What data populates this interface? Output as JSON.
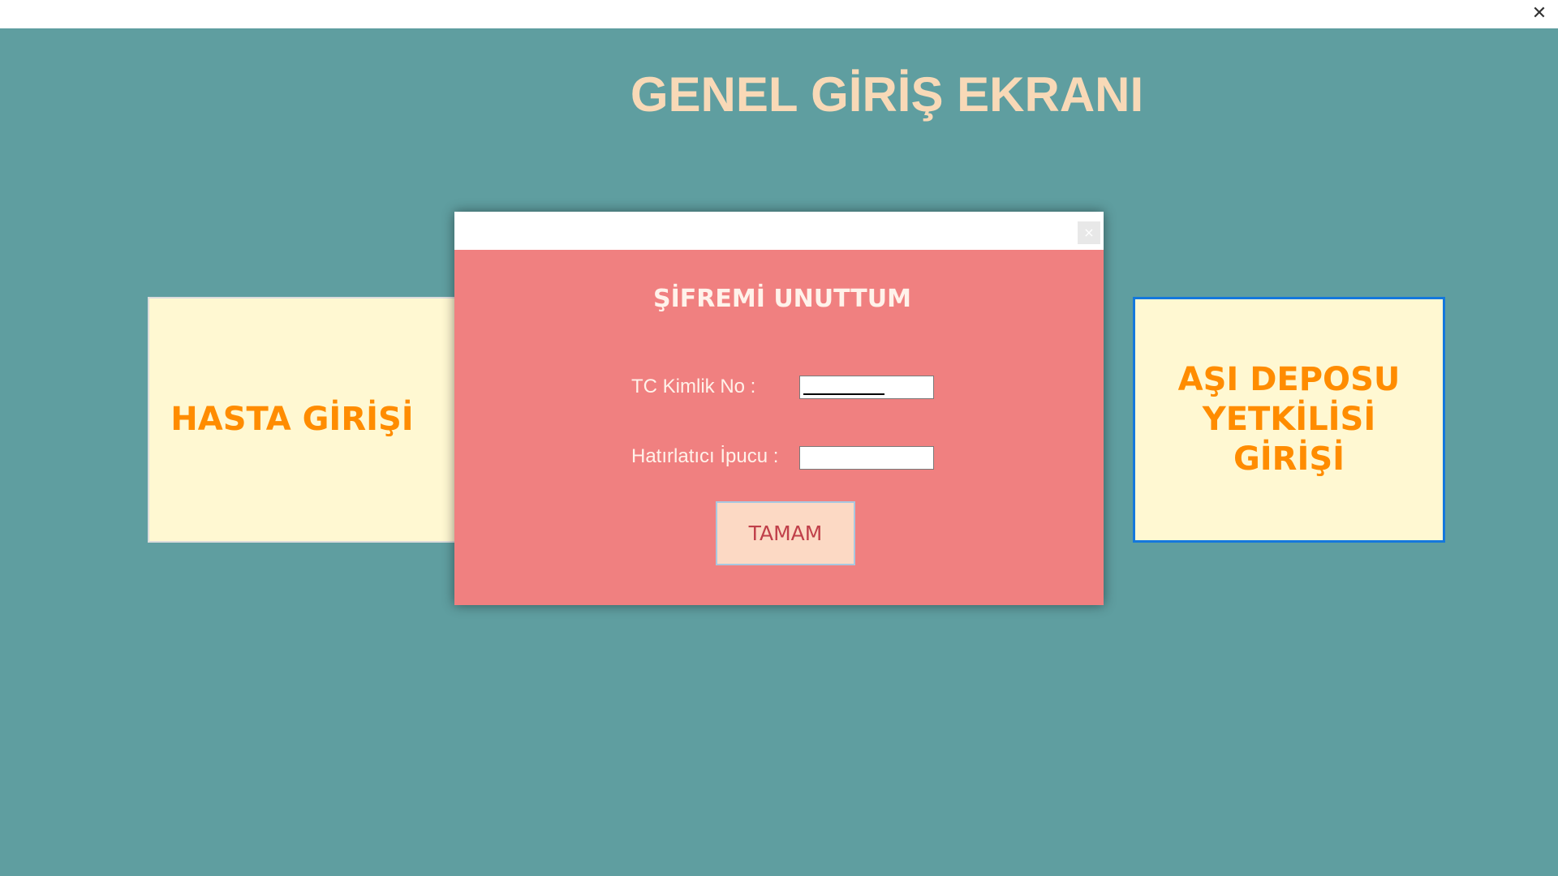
{
  "window": {
    "close_glyph": "✕",
    "title": "GENEL GİRİŞ EKRANI"
  },
  "buttons": {
    "hasta": "HASTA GİRİŞİ",
    "asi_line1": "AŞI DEPOSU",
    "asi_line2": "YETKİLİSİ",
    "asi_line3": "GİRİŞİ"
  },
  "dialog": {
    "close_glyph": "×",
    "heading": "ŞİFREMİ UNUTTUM",
    "tc_label": "TC Kimlik No :",
    "tc_value": "",
    "ipucu_label": "Hatırlatıcı İpucu :",
    "ipucu_value": "",
    "ok_label": "TAMAM"
  },
  "colors": {
    "background": "#5f9ea0",
    "title": "#f8d9b7",
    "tile_bg": "#fff8d2",
    "tile_text": "#ff8c00",
    "dialog_bg": "#f08080",
    "focus_border": "#1478dc"
  }
}
